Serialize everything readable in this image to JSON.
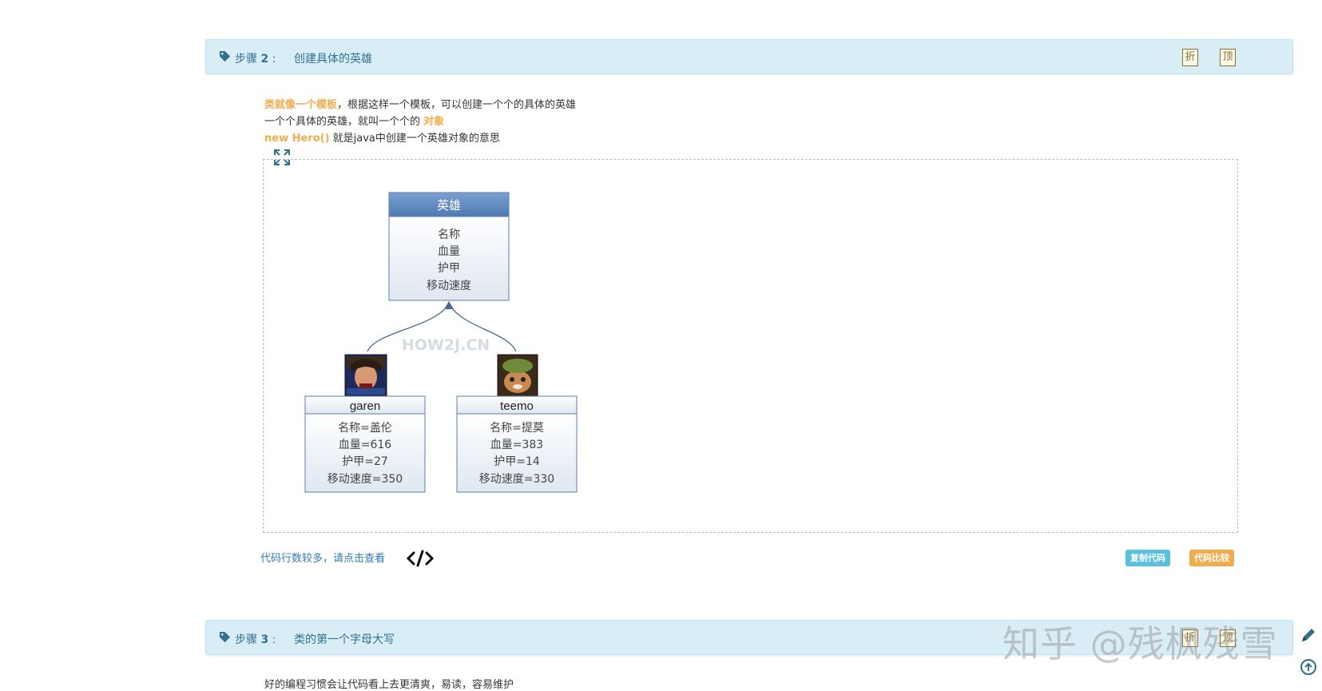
{
  "step2": {
    "label": "步骤",
    "number": "2",
    "colon": ":",
    "title": "创建具体的英雄",
    "fold_button": "折",
    "top_button": "顶"
  },
  "intro": {
    "line1_highlight": "类就像一个模板",
    "line1_rest": "，根据这样一个模板，可以创建一个个的具体的英雄",
    "line2_text": "一个个具体的英雄，就叫一个个的",
    "line2_highlight": "对象",
    "line3_highlight": "new Hero()",
    "line3_rest": " 就是java中创建一个英雄对象的意思"
  },
  "diagram": {
    "class_title": "英雄",
    "class_fields": [
      "名称",
      "血量",
      "护甲",
      "移动速度"
    ],
    "watermark": "HOW2J.CN",
    "objects": [
      {
        "name": "garen",
        "fields": [
          "名称=盖伦",
          "血量=616",
          "护甲=27",
          "移动速度=350"
        ]
      },
      {
        "name": "teemo",
        "fields": [
          "名称=提莫",
          "血量=383",
          "护甲=14",
          "移动速度=330"
        ]
      }
    ]
  },
  "code_footer": {
    "view_text": "代码行数较多，请点击查看",
    "copy_label": "复制代码",
    "compare_label": "代码比较"
  },
  "step3": {
    "label": "步骤",
    "number": "3",
    "colon": ":",
    "title": "类的第一个字母大写",
    "desc": "好的编程习惯会让代码看上去更清爽，易读，容易维护"
  },
  "overlay": {
    "watermark": "知乎 @残枫残雪"
  },
  "colors": {
    "bar_bg": "#d9edf7",
    "bar_text": "#31708f",
    "highlight": "#f0ad4e",
    "copy_badge": "#5bc0de",
    "compare_badge": "#f0ad4e",
    "class_header": "#4f81bd"
  }
}
